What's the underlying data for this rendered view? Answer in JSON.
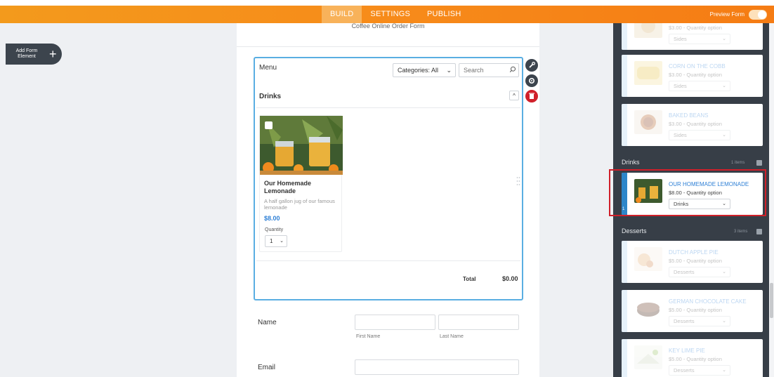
{
  "topbar": {
    "tabs": [
      {
        "label": "BUILD",
        "active": true
      },
      {
        "label": "SETTINGS",
        "active": false
      },
      {
        "label": "PUBLISH",
        "active": false
      }
    ],
    "preview_label": "Preview Form",
    "preview_on": true
  },
  "sidebar_button": {
    "label": "Add Form Element",
    "icon": "plus-icon"
  },
  "form": {
    "title": "Coffee Online Order Form",
    "menu": {
      "title": "Menu",
      "category_value": "Categories: All",
      "search_placeholder": "Search",
      "section_title": "Drinks",
      "item": {
        "name": "Our Homemade Lemonade",
        "description": "A half gallon jug of our famous lemonade",
        "price": "$8.00",
        "quantity_label": "Quantity",
        "quantity_value": "1"
      },
      "total_label": "Total",
      "total_value": "$0.00"
    },
    "name_field": {
      "label": "Name",
      "first_label": "First Name",
      "last_label": "Last Name"
    },
    "email_field": {
      "label": "Email"
    }
  },
  "tools": [
    {
      "icon": "wrench-icon",
      "color": "#3c444d"
    },
    {
      "icon": "gear-icon",
      "color": "#3c444d"
    },
    {
      "icon": "trash-icon",
      "color": "#d0202a"
    }
  ],
  "panel": {
    "top_items": [
      {
        "title": "",
        "price": "$3.00 - Quantity option",
        "category": "Sides"
      },
      {
        "title": "CORN ON THE COBB",
        "price": "$3.00 - Quantity option",
        "category": "Sides"
      },
      {
        "title": "BAKED BEANS",
        "price": "$3.00 - Quantity option",
        "category": "Sides"
      }
    ],
    "drinks": {
      "title": "Drinks",
      "count": "1 items",
      "items": [
        {
          "title": "OUR HOMEMADE LEMONADE",
          "price": "$8.00 - Quantity option",
          "category": "Drinks",
          "index": "1"
        }
      ]
    },
    "desserts": {
      "title": "Desserts",
      "count": "3 items",
      "items": [
        {
          "title": "DUTCH APPLE PIE",
          "price": "$5.00 - Quantity option",
          "category": "Desserts"
        },
        {
          "title": "GERMAN CHOCOLATE CAKE",
          "price": "$5.00 - Quantity option",
          "category": "Desserts"
        },
        {
          "title": "KEY LIME PIE",
          "price": "$5.00 - Quantity option",
          "category": "Desserts"
        }
      ]
    }
  },
  "colors": {
    "topbar": "#f7931e",
    "accent": "#2f80d6",
    "panel_bg": "#373e47",
    "highlight": "#d0202a",
    "selected_border": "#5aaee2"
  }
}
